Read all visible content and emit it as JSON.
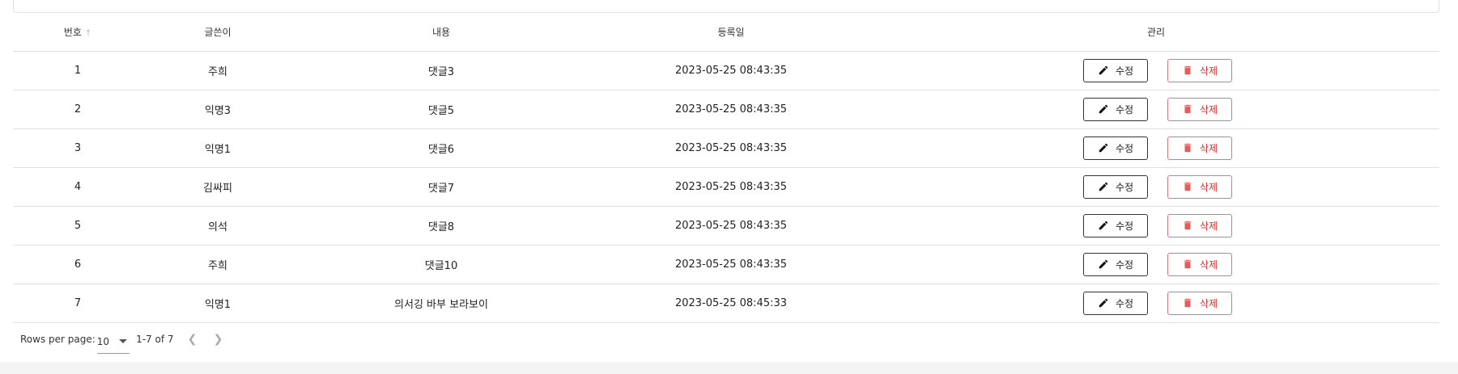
{
  "table": {
    "headers": {
      "no": "번호",
      "author": "글쓴이",
      "content": "내용",
      "date": "등록일",
      "manage": "관리"
    },
    "rows": [
      {
        "no": "1",
        "author": "주희",
        "content": "댓글3",
        "date": "2023-05-25 08:43:35"
      },
      {
        "no": "2",
        "author": "익명3",
        "content": "댓글5",
        "date": "2023-05-25 08:43:35"
      },
      {
        "no": "3",
        "author": "익명1",
        "content": "댓글6",
        "date": "2023-05-25 08:43:35"
      },
      {
        "no": "4",
        "author": "김싸피",
        "content": "댓글7",
        "date": "2023-05-25 08:43:35"
      },
      {
        "no": "5",
        "author": "의석",
        "content": "댓글8",
        "date": "2023-05-25 08:43:35"
      },
      {
        "no": "6",
        "author": "주희",
        "content": "댓글10",
        "date": "2023-05-25 08:43:35"
      },
      {
        "no": "7",
        "author": "익명1",
        "content": "의서깅 바부 보라보이",
        "date": "2023-05-25 08:45:33"
      }
    ],
    "edit_label": "수정",
    "delete_label": "삭제"
  },
  "pagination": {
    "rows_per_page_label": "Rows per page:",
    "rows_per_page_value": "10",
    "range": "1-7 of 7"
  },
  "icons": {
    "sort": "arrow-up-icon",
    "edit": "pencil-icon",
    "delete": "trash-icon",
    "prev": "chevron-left-icon",
    "next": "chevron-right-icon"
  },
  "colors": {
    "delete_accent": "#d32f2f",
    "edit_border": "#333333"
  }
}
